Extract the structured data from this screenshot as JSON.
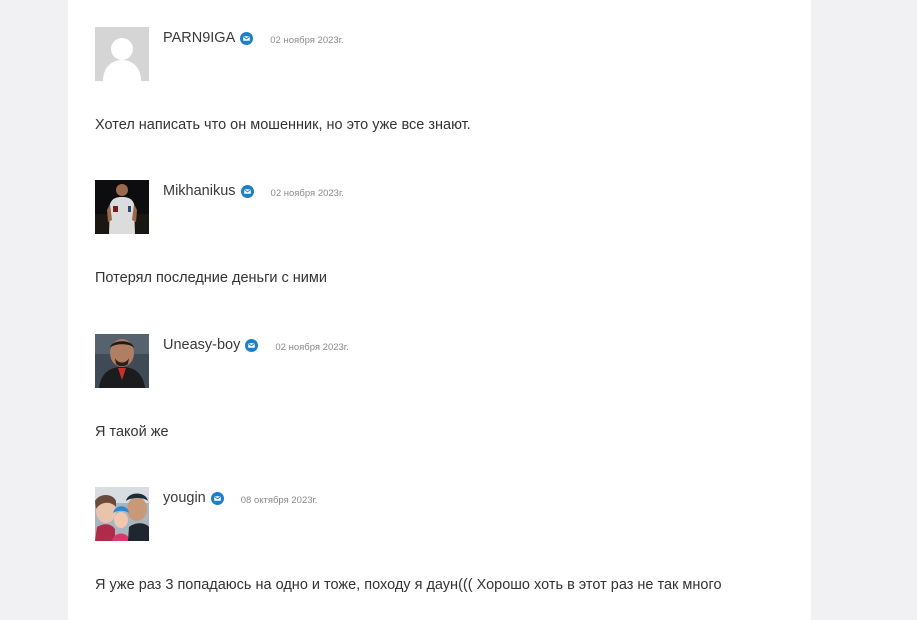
{
  "comments": [
    {
      "author": "PARN9IGA",
      "date": "02 ноября 2023г.",
      "text": "Хотел написать что он мошенник, но это уже все знают.",
      "avatar": "default-user-avatar"
    },
    {
      "author": "Mikhanikus",
      "date": "02 ноября 2023г.",
      "text": "Потерял последние деньги с ними",
      "avatar": "man-in-dark-photo-avatar"
    },
    {
      "author": "Uneasy-boy",
      "date": "02 ноября 2023г.",
      "text": "Я такой же",
      "avatar": "man-portrait-photo-avatar"
    },
    {
      "author": "yougin",
      "date": "08 октября 2023г.",
      "text": "Я уже раз 3 попадаюсь на одно и тоже, походу я даун((( Хорошо хоть в этот раз не так много",
      "avatar": "family-photo-avatar"
    }
  ],
  "colors": {
    "badge": "#1d7fc6",
    "page_background": "#f1f1f3",
    "card_background": "#ffffff",
    "author_text": "#3a3a3a",
    "date_text": "#8a8a8a"
  },
  "icons": {
    "badge": "envelope-badge-icon"
  }
}
